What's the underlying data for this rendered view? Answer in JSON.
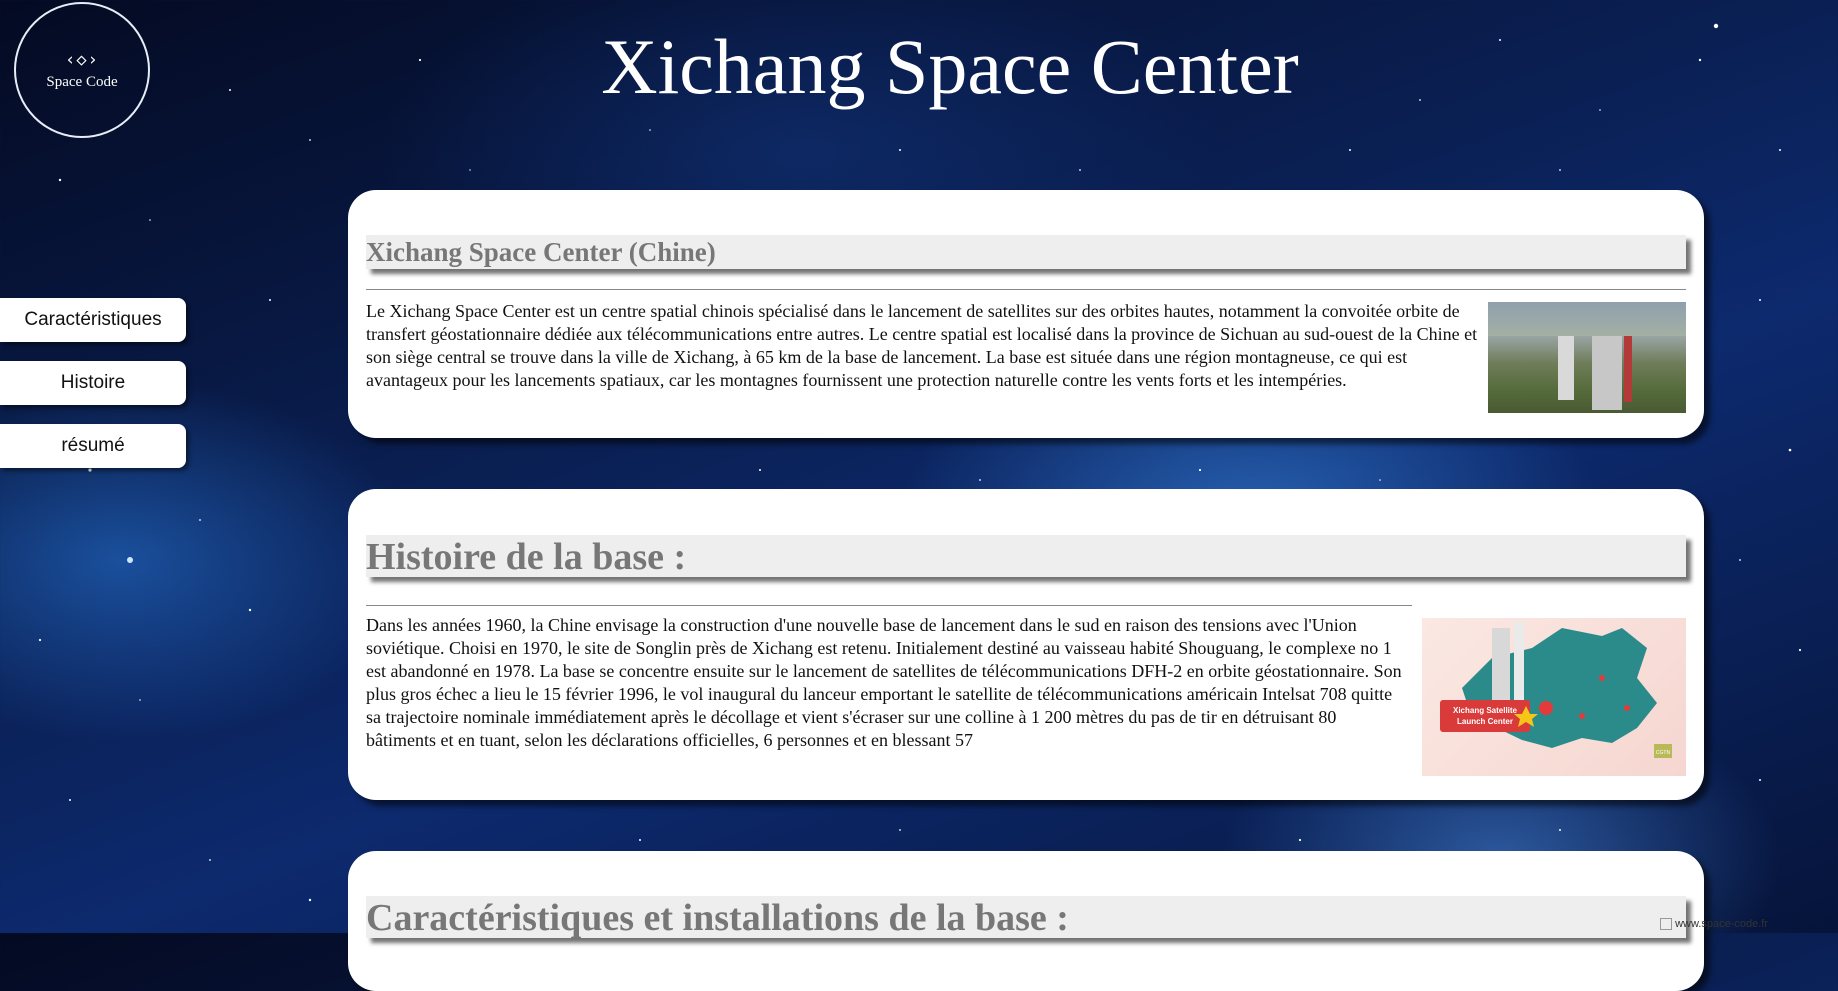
{
  "header": {
    "title": "Xichang Space Center",
    "logo_text": "Space Code",
    "logo_glyph": "‹◇›"
  },
  "sidenav": {
    "items": [
      {
        "label": "Caractéristiques"
      },
      {
        "label": "Histoire"
      },
      {
        "label": "résumé"
      }
    ]
  },
  "sections": [
    {
      "heading": "Xichang Space Center (Chine)",
      "text": "Le Xichang Space Center est un centre spatial chinois spécialisé dans le lancement de satellites sur des orbites hautes, notamment la convoitée orbite de transfert géostationnaire dédiée aux télécommunications entre autres. Le centre spatial est localisé dans la province de Sichuan au sud-ouest de la Chine et son siège central se trouve dans la ville de Xichang, à 65 km de la base de lancement. La base est située dans une région montagneuse, ce qui est avantageux pour les lancements spatiaux, car les montagnes fournissent une protection naturelle contre les vents forts et les intempéries."
    },
    {
      "heading": "Histoire de la base :",
      "text": "Dans les années 1960, la Chine envisage la construction d'une nouvelle base de lancement dans le sud en raison des tensions avec l'Union soviétique. Choisi en 1970, le site de Songlin près de Xichang est retenu. Initialement destiné au vaisseau habité Shouguang, le complexe no 1 est abandonné en 1978. La base se concentre ensuite sur le lancement de satellites de télécommunications DFH-2 en orbite géostationnaire. Son plus gros échec a lieu le 15 février 1996, le vol inaugural du lanceur emportant le satellite de télécommunications américain Intelsat 708 quitte sa trajectoire nominale immédiatement après le décollage et vient s'écraser sur une colline à 1 200 mètres du pas de tir en détruisant 80 bâtiments et en tuant, selon les déclarations officielles, 6 personnes et en blessant 57",
      "image_caption": "Xichang Satellite Launch Center",
      "image_badge": "CGTN"
    },
    {
      "heading": "Caractéristiques et installations de la base :"
    }
  ],
  "broken_image_alt": "www.space-code.fr",
  "colors": {
    "card_bg": "#ffffff",
    "heading_bg": "#eeeeee",
    "heading_text": "#777777",
    "map_teal": "#2b8a8a",
    "map_red": "#d93a3a"
  }
}
